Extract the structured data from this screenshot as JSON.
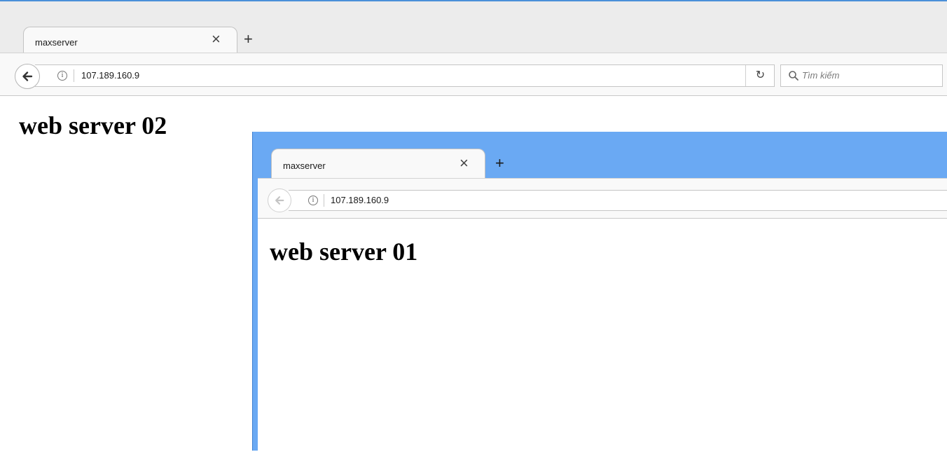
{
  "back_window": {
    "tab": {
      "title": "maxserver",
      "close": "×",
      "new_tab": "+"
    },
    "navbar": {
      "url": "107.189.160.9",
      "search_placeholder": "Tìm kiếm"
    },
    "page": {
      "heading": "web server 02"
    }
  },
  "front_window": {
    "tab": {
      "title": "maxserver",
      "close": "×",
      "new_tab": "+"
    },
    "navbar": {
      "url": "107.189.160.9"
    },
    "page": {
      "heading": "web server 01"
    }
  },
  "colors": {
    "front_window_frame": "#6aa9f3",
    "back_window_tabstrip": "#ececec"
  },
  "icons": [
    "back-arrow-icon",
    "info-icon",
    "reload-icon",
    "search-icon",
    "close-icon",
    "plus-icon"
  ]
}
